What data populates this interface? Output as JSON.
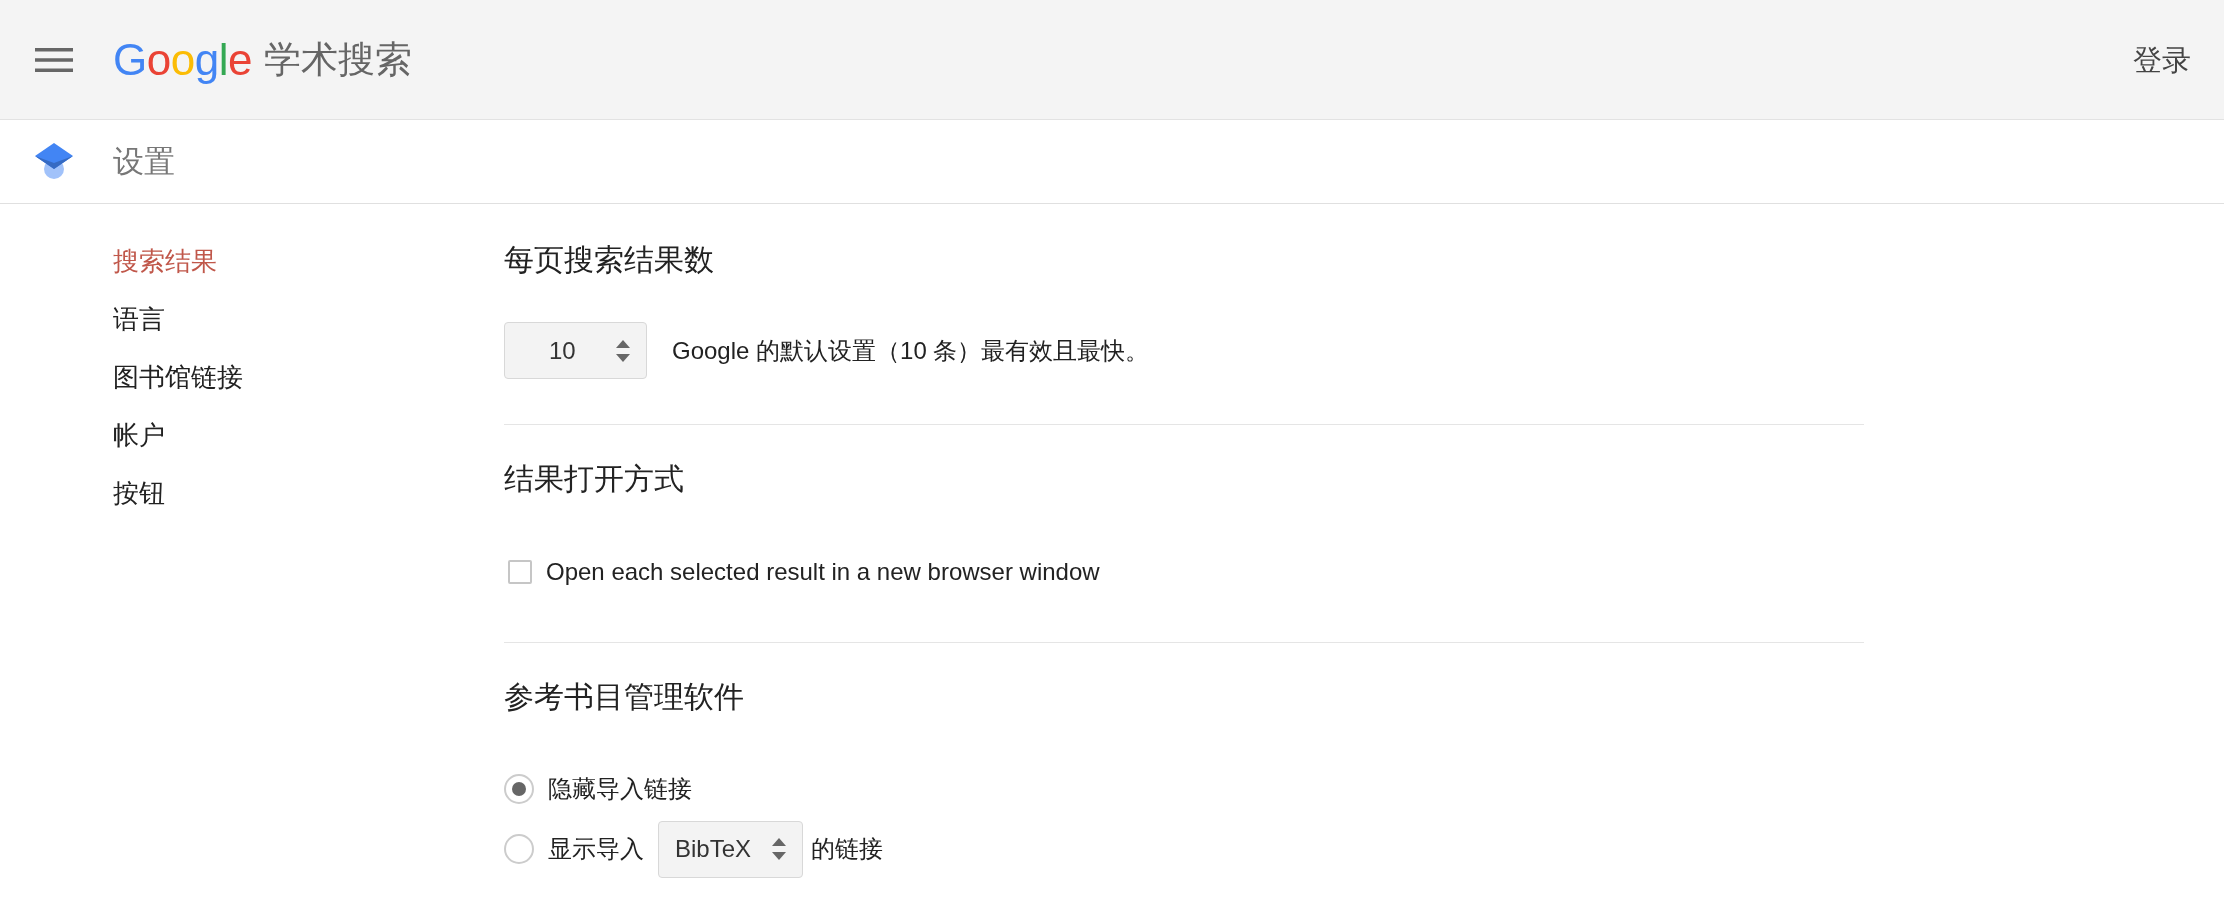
{
  "header": {
    "logo": "Google",
    "product": "学术搜索",
    "sign_in": "登录"
  },
  "page_bar": {
    "title": "设置"
  },
  "sidebar": {
    "items": [
      {
        "label": "搜索结果",
        "selected": true
      },
      {
        "label": "语言",
        "selected": false
      },
      {
        "label": "图书馆链接",
        "selected": false
      },
      {
        "label": "帐户",
        "selected": false
      },
      {
        "label": "按钮",
        "selected": false
      }
    ]
  },
  "sections": [
    {
      "kind": "results_per_page",
      "heading": "每页搜索结果数",
      "select_value": "10",
      "note": "Google 的默认设置（10 条）最有效且最快。"
    },
    {
      "kind": "open_mode",
      "heading": "结果打开方式",
      "checkbox": {
        "label": "Open each selected result in a new browser window",
        "checked": false
      }
    },
    {
      "kind": "bibliography",
      "heading": "参考书目管理软件",
      "options": [
        {
          "kind": "plain",
          "label": "隐藏导入链接",
          "selected": true
        },
        {
          "kind": "with_select",
          "label": "显示导入",
          "select_value": "BibTeX",
          "suffix": "的链接",
          "selected": false
        }
      ]
    }
  ]
}
